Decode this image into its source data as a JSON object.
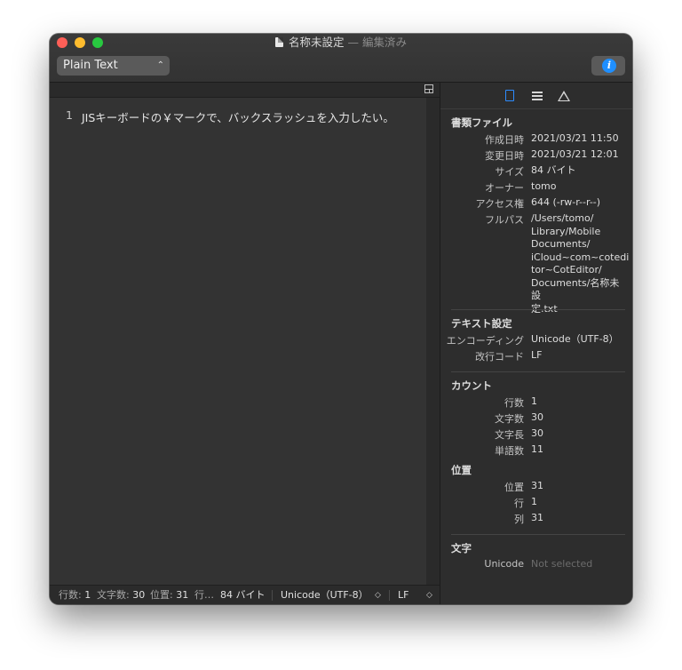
{
  "window": {
    "title": "名称未設定",
    "edited_suffix": "— 編集済み"
  },
  "toolbar": {
    "syntax_style": "Plain Text",
    "info_icon": "info-icon"
  },
  "editor": {
    "line_number": "1",
    "line_text": "JISキーボードの￥マークで、バックスラッシュを入力したい。"
  },
  "statusbar": {
    "lines_label": "行数:",
    "lines_value": "1",
    "chars_label": "文字数:",
    "chars_value": "30",
    "location_label": "位置:",
    "location_value": "31",
    "line_label": "行…",
    "file_size": "84 バイト",
    "encoding": "Unicode（UTF-8）",
    "line_ending": "LF"
  },
  "inspector": {
    "tabs": [
      "document-icon",
      "outline-icon",
      "warning-icon"
    ],
    "file": {
      "heading": "書類ファイル",
      "rows": [
        {
          "label": "作成日時",
          "value": "2021/03/21 11:50"
        },
        {
          "label": "変更日時",
          "value": "2021/03/21 12:01"
        },
        {
          "label": "サイズ",
          "value": "84 バイト"
        },
        {
          "label": "オーナー",
          "value": "tomo"
        },
        {
          "label": "アクセス権",
          "value": "644 (-rw-r--r--)"
        }
      ],
      "fullpath_label": "フルパス",
      "fullpath_lines": [
        "/Users/tomo/",
        "Library/Mobile",
        "Documents/",
        "iCloud~com~cotedi",
        "tor~CotEditor/",
        "Documents/名称未設",
        "定.txt"
      ]
    },
    "text_settings": {
      "heading": "テキスト設定",
      "rows": [
        {
          "label": "エンコーディング",
          "value": "Unicode（UTF-8）"
        },
        {
          "label": "改行コード",
          "value": "LF"
        }
      ]
    },
    "count": {
      "heading": "カウント",
      "rows": [
        {
          "label": "行数",
          "value": "1"
        },
        {
          "label": "文字数",
          "value": "30"
        },
        {
          "label": "文字長",
          "value": "30"
        },
        {
          "label": "単語数",
          "value": "11"
        }
      ]
    },
    "location": {
      "heading": "位置",
      "rows": [
        {
          "label": "位置",
          "value": "31"
        },
        {
          "label": "行",
          "value": "1"
        },
        {
          "label": "列",
          "value": "31"
        }
      ]
    },
    "character": {
      "heading": "文字",
      "rows": [
        {
          "label": "Unicode",
          "value": "Not selected"
        }
      ]
    }
  }
}
